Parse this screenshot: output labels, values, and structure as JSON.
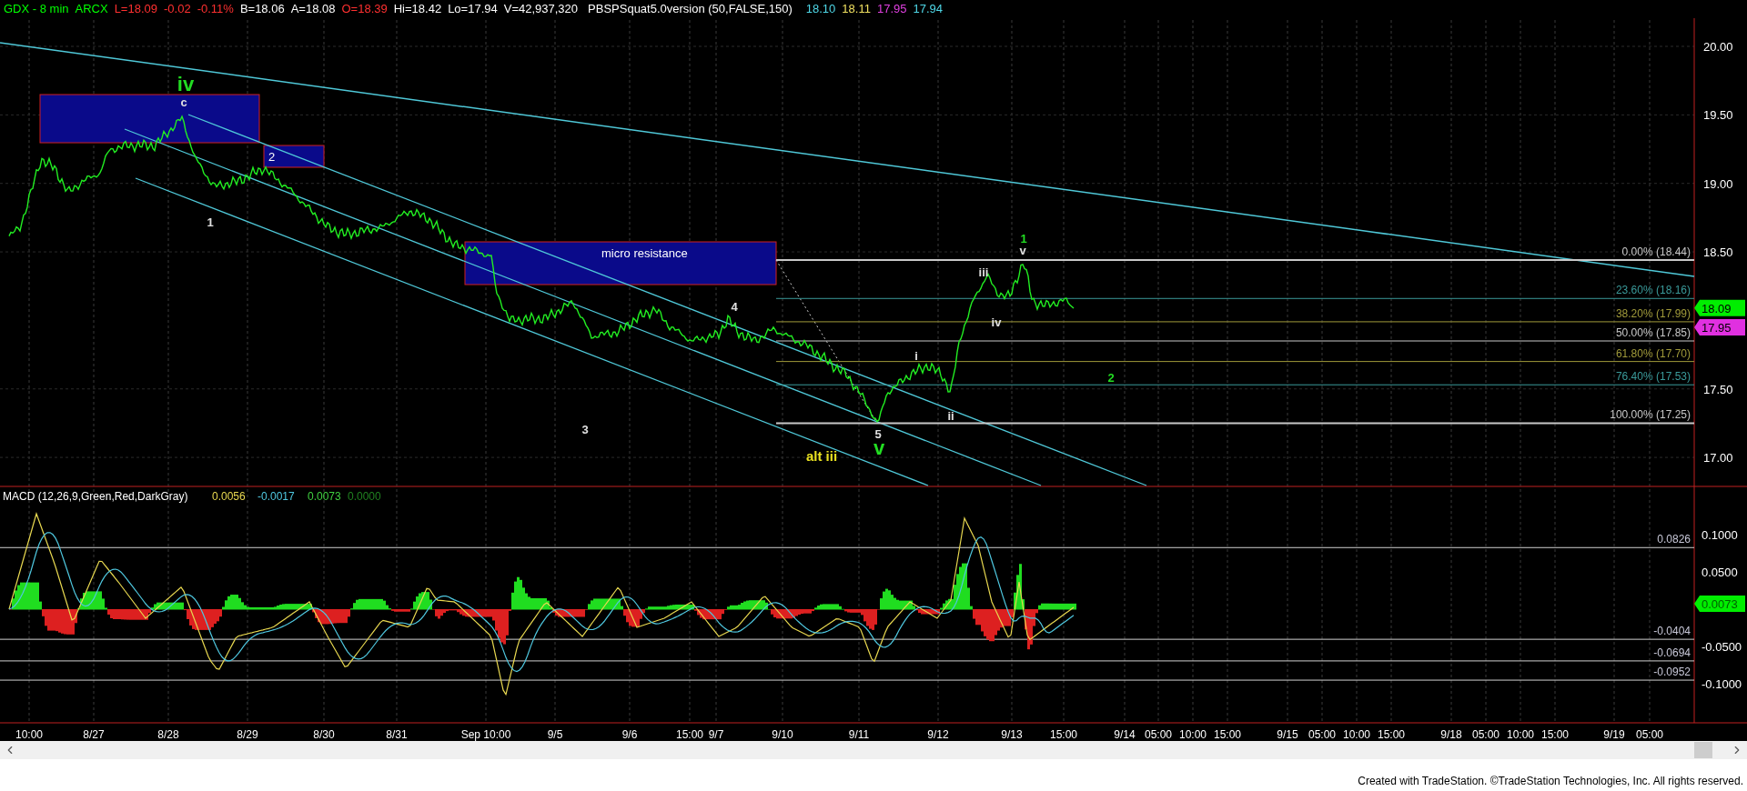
{
  "header": [
    {
      "text": "GDX - 8 min",
      "color": "#00ff00"
    },
    {
      "text": "ARCX",
      "color": "#00ff00"
    },
    {
      "text": "L=18.09",
      "color": "#ff3030"
    },
    {
      "text": "-0.02",
      "color": "#ff3030"
    },
    {
      "text": "-0.11%",
      "color": "#ff3030"
    },
    {
      "text": "B=18.06",
      "color": "#ffffff"
    },
    {
      "text": "A=18.08",
      "color": "#ffffff"
    },
    {
      "text": "O=18.39",
      "color": "#ff3030"
    },
    {
      "text": "Hi=18.42",
      "color": "#ffffff"
    },
    {
      "text": "Lo=17.94",
      "color": "#ffffff"
    },
    {
      "text": "V=42,937,320",
      "color": "#ffffff"
    },
    {
      "text": "PBSPSquat5.0version (50,FALSE,150)",
      "color": "#ffffff"
    },
    {
      "text": "18.10",
      "color": "#4fd8e8"
    },
    {
      "text": "18.11",
      "color": "#f0e060"
    },
    {
      "text": "17.95",
      "color": "#e040e0"
    },
    {
      "text": "17.94",
      "color": "#4fd8e8"
    }
  ],
  "price_panel": {
    "axis_ticks": [
      "20.00",
      "19.50",
      "19.00",
      "18.50",
      "17.50",
      "17.00"
    ],
    "markers": [
      {
        "text": "18.09",
        "color": "#00ee00"
      },
      {
        "text": "17.95",
        "color": "#e030e0"
      }
    ],
    "fib_levels": [
      {
        "text": "0.00% (18.44)",
        "color": "#c8c8c8"
      },
      {
        "text": "23.60% (18.16)",
        "color": "#3a9a9a"
      },
      {
        "text": "38.20% (17.99)",
        "color": "#a09a3a"
      },
      {
        "text": "50.00% (17.85)",
        "color": "#c8c8c8"
      },
      {
        "text": "61.80% (17.70)",
        "color": "#a09a3a"
      },
      {
        "text": "76.40% (17.53)",
        "color": "#3a9a9a"
      },
      {
        "text": "100.00% (17.25)",
        "color": "#c8c8c8"
      }
    ],
    "zones": [
      {
        "kind": "box"
      },
      {
        "kind": "box",
        "label": "2"
      },
      {
        "kind": "box",
        "label": "micro resistance"
      }
    ],
    "wave_labels": [
      {
        "text": "iv",
        "kind": "major",
        "color": "#22dd22"
      },
      {
        "text": "c",
        "kind": "minor",
        "color": "#e0e0e0"
      },
      {
        "text": "1",
        "kind": "minor",
        "color": "#e0e0e0"
      },
      {
        "text": "3",
        "kind": "minor",
        "color": "#e0e0e0"
      },
      {
        "text": "4",
        "kind": "minor",
        "color": "#e0e0e0"
      },
      {
        "text": "5",
        "kind": "minor",
        "color": "#e0e0e0"
      },
      {
        "text": "alt iii",
        "kind": "major",
        "color": "#e8e020"
      },
      {
        "text": "v",
        "kind": "major",
        "color": "#22dd22"
      },
      {
        "text": "i",
        "kind": "minor",
        "color": "#e0e0e0"
      },
      {
        "text": "ii",
        "kind": "minor",
        "color": "#e0e0e0"
      },
      {
        "text": "iii",
        "kind": "minor",
        "color": "#e0e0e0"
      },
      {
        "text": "iv",
        "kind": "minor",
        "color": "#e0e0e0"
      },
      {
        "text": "1",
        "kind": "minor",
        "color": "#22dd22"
      },
      {
        "text": "v",
        "kind": "minor",
        "color": "#e0e0e0"
      },
      {
        "text": "2",
        "kind": "minor",
        "color": "#22dd22"
      }
    ]
  },
  "macd_panel": {
    "legend": [
      {
        "text": "MACD (12,26,9,Green,Red,DarkGray)",
        "color": "#ffffff"
      },
      {
        "text": "0.0056",
        "color": "#e8d850"
      },
      {
        "text": "-0.0017",
        "color": "#4fc8e0"
      },
      {
        "text": "0.0073",
        "color": "#40d040"
      },
      {
        "text": "0.0000",
        "color": "#208020"
      }
    ],
    "axis_ticks": [
      "0.1000",
      "0.0500",
      "-0.0500",
      "-0.1000"
    ],
    "marker": {
      "text": "0.0073",
      "color": "#00ee00"
    },
    "levels": [
      "0.0826",
      "-0.0404",
      "-0.0694",
      "-0.0952"
    ]
  },
  "time_axis": [
    "10:00",
    "8/27",
    "8/28",
    "8/29",
    "8/30",
    "8/31",
    "Sep 10:00",
    "9/5",
    "9/6",
    "15:00",
    "9/7",
    "9/10",
    "9/11",
    "9/12",
    "9/13",
    "15:00",
    "9/14",
    "05:00",
    "10:00",
    "15:00",
    "9/15",
    "05:00",
    "10:00",
    "15:00",
    "9/18",
    "05:00",
    "10:00",
    "15:00",
    "9/19",
    "05:00"
  ],
  "footer": "Created with TradeStation. ©TradeStation Technologies, Inc. All rights reserved."
}
